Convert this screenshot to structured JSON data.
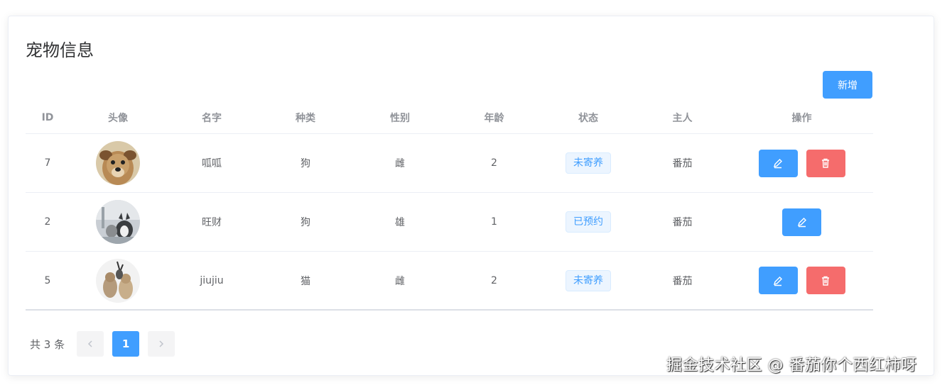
{
  "title": "宠物信息",
  "add_label": "新增",
  "columns": [
    "ID",
    "头像",
    "名字",
    "种类",
    "性别",
    "年龄",
    "状态",
    "主人",
    "操作"
  ],
  "rows": [
    {
      "id": "7",
      "avatar": "dog-avatar",
      "name": "呱呱",
      "kind": "狗",
      "sex": "雌",
      "age": "2",
      "status": "未寄养",
      "owner": "番茄",
      "ops": [
        "edit",
        "delete"
      ]
    },
    {
      "id": "2",
      "avatar": "dog-cat-avatar",
      "name": "旺财",
      "kind": "狗",
      "sex": "雄",
      "age": "1",
      "status": "已预约",
      "owner": "番茄",
      "ops": [
        "edit"
      ]
    },
    {
      "id": "5",
      "avatar": "cats-avatar",
      "name": "jiujiu",
      "kind": "猫",
      "sex": "雌",
      "age": "2",
      "status": "未寄养",
      "owner": "番茄",
      "ops": [
        "edit",
        "delete"
      ]
    }
  ],
  "pagination": {
    "total": "共 3 条",
    "current": "1"
  },
  "watermark": "掘金技术社区 @ 番茄你个西红柿呀",
  "colors": {
    "primary": "#409eff",
    "danger": "#f56c6c",
    "tag_bg": "#ecf5ff"
  }
}
